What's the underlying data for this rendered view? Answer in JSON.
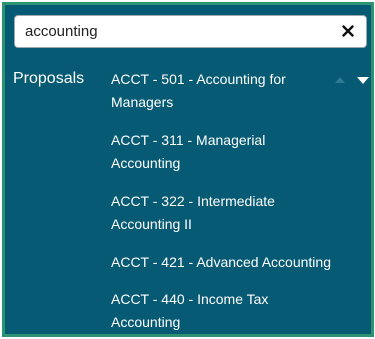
{
  "search": {
    "value": "accounting",
    "clear_icon": "close-icon"
  },
  "group": {
    "label": "Proposals"
  },
  "options": [
    {
      "line1": "ACCT - 501 - Accounting for",
      "line2": "Managers"
    },
    {
      "line1": "ACCT - 311 - Managerial",
      "line2": "Accounting"
    },
    {
      "line1": "ACCT - 322 - Intermediate",
      "line2": "Accounting II"
    },
    {
      "line1": "ACCT - 421 - Advanced Accounting",
      "line2": ""
    },
    {
      "line1": "ACCT - 440 - Income Tax",
      "line2": "Accounting"
    }
  ],
  "scroll_icons": {
    "up": "triangle-up-icon",
    "down": "triangle-down-icon"
  },
  "colors": {
    "panel_bg": "#065a73",
    "panel_border": "#2c9370",
    "text": "#ffffff"
  }
}
